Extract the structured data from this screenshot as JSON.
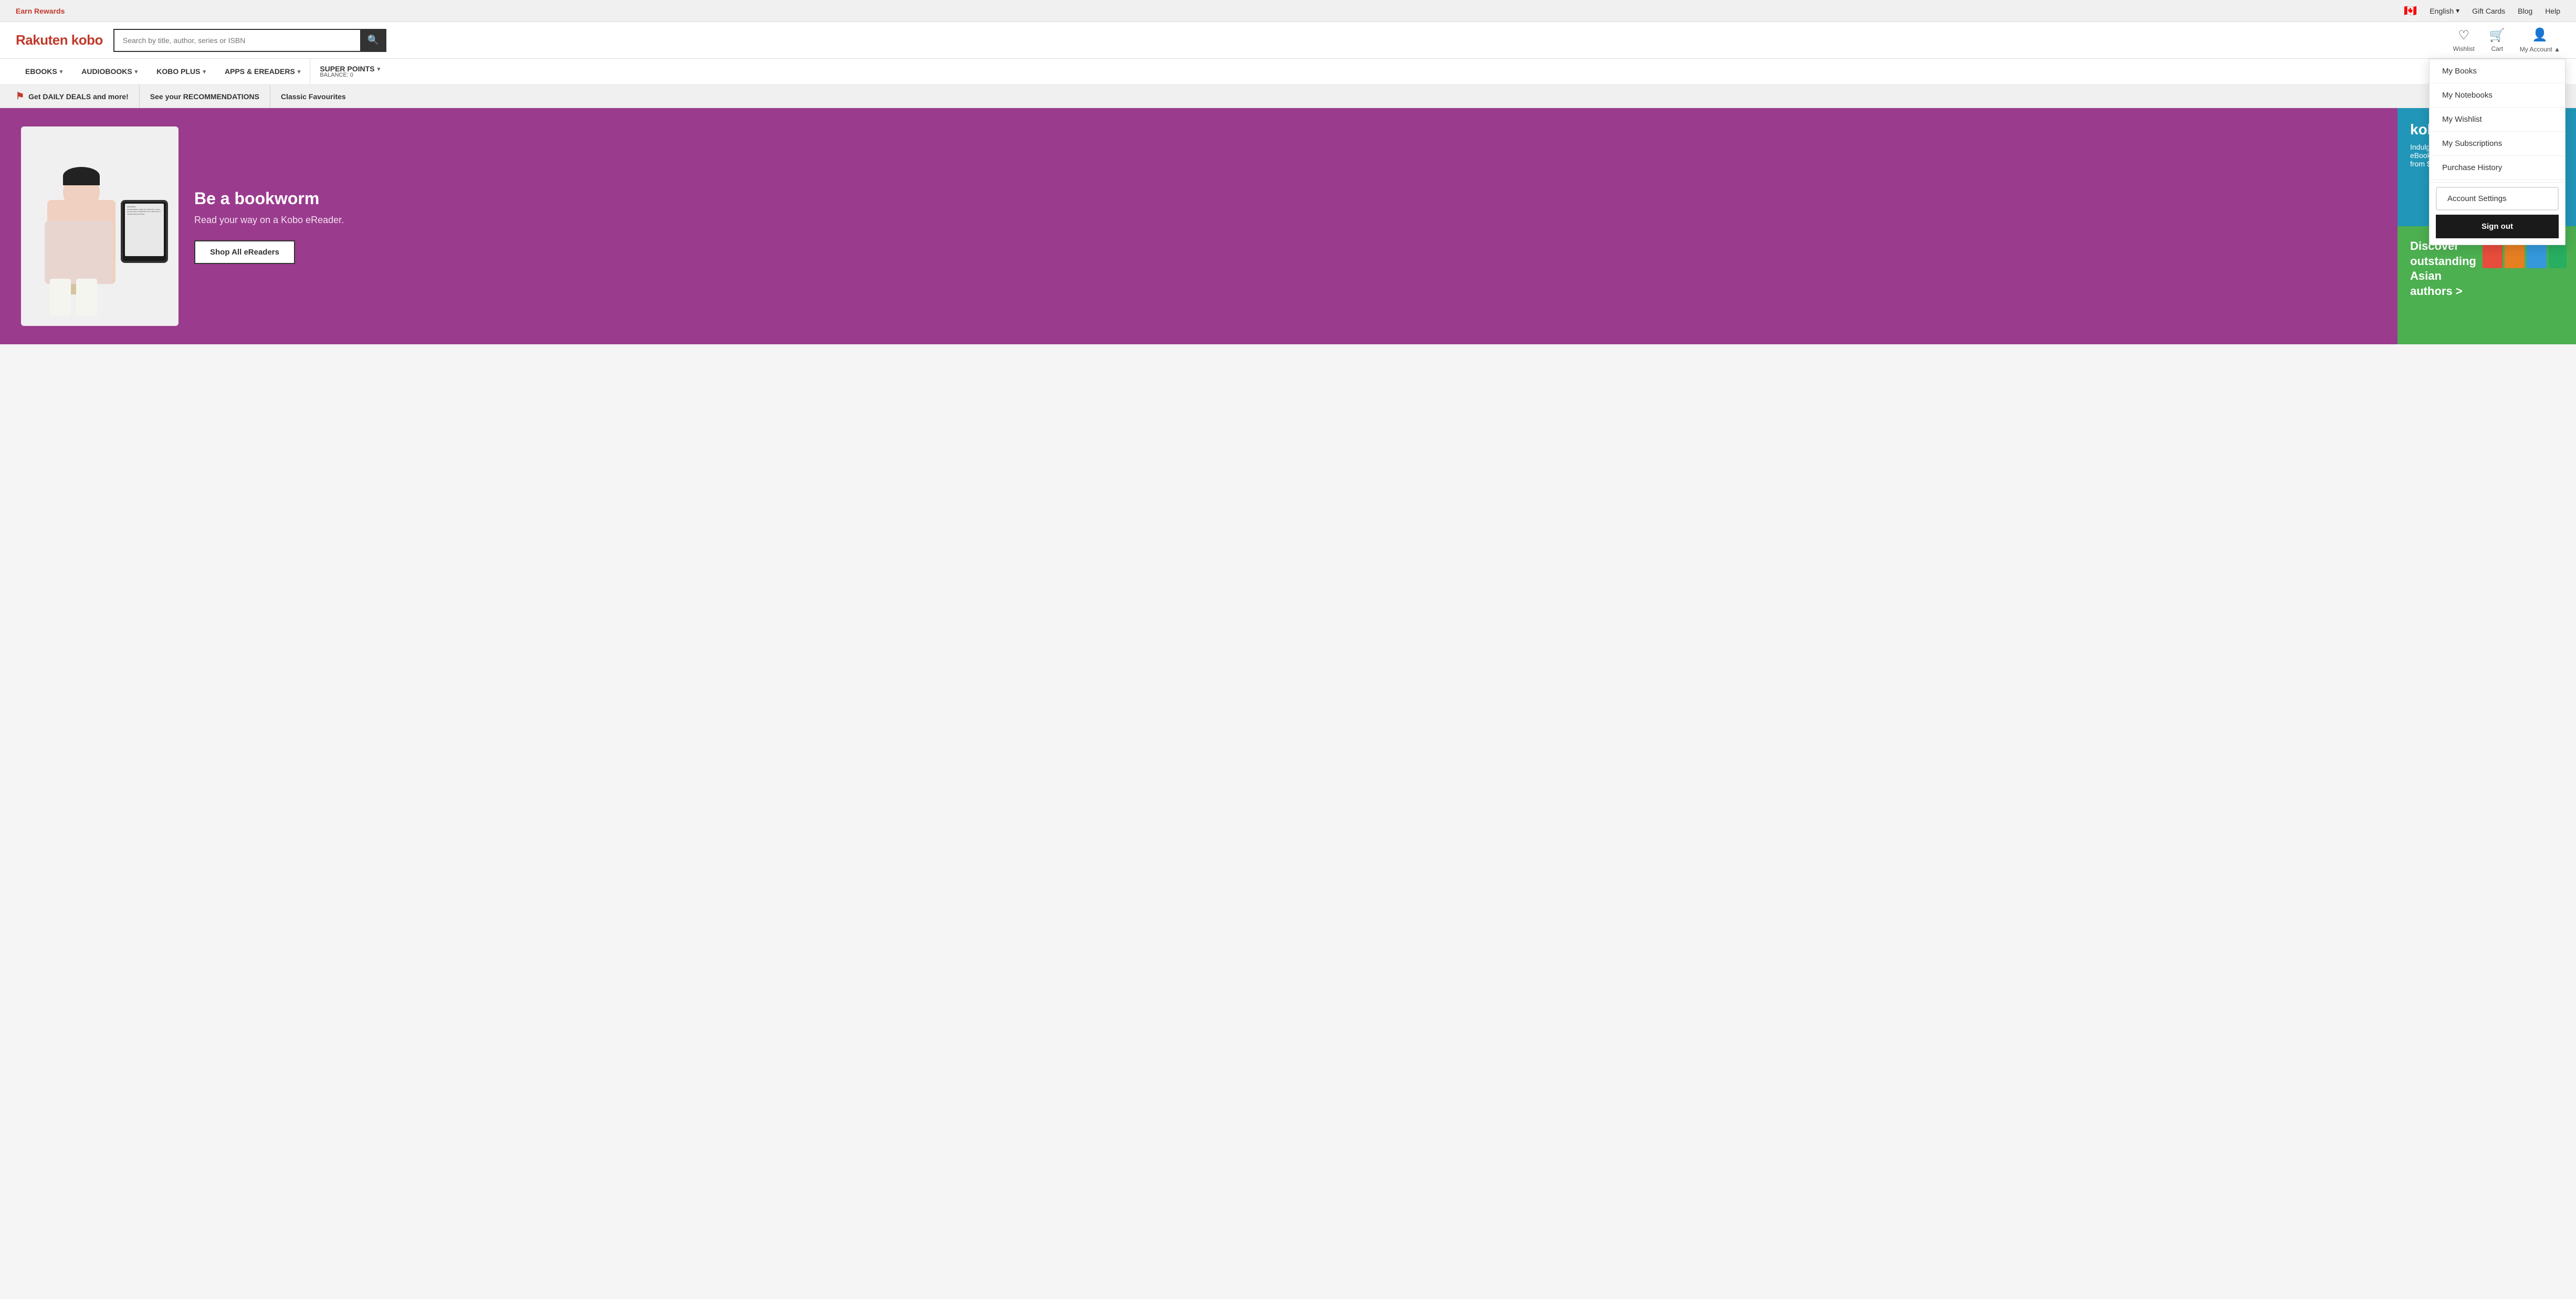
{
  "topbar": {
    "earn_rewards": "Earn Rewards",
    "flag": "🇨🇦",
    "language": "English",
    "gift_cards": "Gift Cards",
    "blog": "Blog",
    "help": "Help"
  },
  "header": {
    "logo": "Rakuten kobo",
    "search_placeholder": "Search by title, author, series or ISBN",
    "wishlist_label": "Wishlist",
    "cart_label": "Cart",
    "my_account_label": "My Account"
  },
  "nav": {
    "items": [
      {
        "label": "eBOOKS",
        "has_chevron": true
      },
      {
        "label": "AUDIOBOOKS",
        "has_chevron": true
      },
      {
        "label": "KOBO PLUS",
        "has_chevron": true
      },
      {
        "label": "APPS & eREADERS",
        "has_chevron": true
      },
      {
        "label": "SUPER POINTS",
        "has_chevron": true
      }
    ],
    "balance_label": "Balance: 0"
  },
  "promo_strip": {
    "items": [
      {
        "text": "Get DAILY DEALS and more!",
        "has_flag": true
      },
      {
        "text": "See your RECOMMENDATIONS",
        "has_flag": false
      },
      {
        "text": "Classic Favourites",
        "has_flag": false
      }
    ]
  },
  "hero": {
    "title": "Be a bookworm",
    "subtitle": "Read your way on a Kobo eReader.",
    "cta": "Shop All eReaders"
  },
  "panel_kobo": {
    "title": "kobo p",
    "subtitle": "Indulge in unlimited\neBooks\nfrom $9"
  },
  "panel_asian": {
    "title": "Discover outstanding Asian authors >",
    "books": [
      {
        "color": "#e74c3c"
      },
      {
        "color": "#e67e22"
      },
      {
        "color": "#3498db"
      },
      {
        "color": "#2ecc71"
      }
    ]
  },
  "dropdown": {
    "items": [
      {
        "label": "My Books",
        "highlighted": false
      },
      {
        "label": "My Notebooks",
        "highlighted": false
      },
      {
        "label": "My Wishlist",
        "highlighted": false
      },
      {
        "label": "My Subscriptions",
        "highlighted": false
      },
      {
        "label": "Purchase History",
        "highlighted": false
      },
      {
        "label": "Account Settings",
        "highlighted": true
      }
    ],
    "sign_out": "Sign out"
  },
  "ereader_text": "CHAPTER 9 · 1 OF 19\n\nIt was pleasant to wake up in Florence, to open the eyes upon a bright bare room, with a floor of red tiles which look clean though they are not; with a painted ceiling whereon pink griffins and blue amorini sport in a forest of yellow violins and bassoons. It was pleasant, too, to fling wide the windows, pinching the fingers in unfamiliar fastenings, to lean out into sunshine with beautiful hills and trees and marble churches opposite, and, close below, the Arno, gurgling against the embankment of the road.\n\nOver the river men were at work with spades and sieves on the sandy foreshore, and on the river was a boat, also diligently employed for some mysterious end."
}
